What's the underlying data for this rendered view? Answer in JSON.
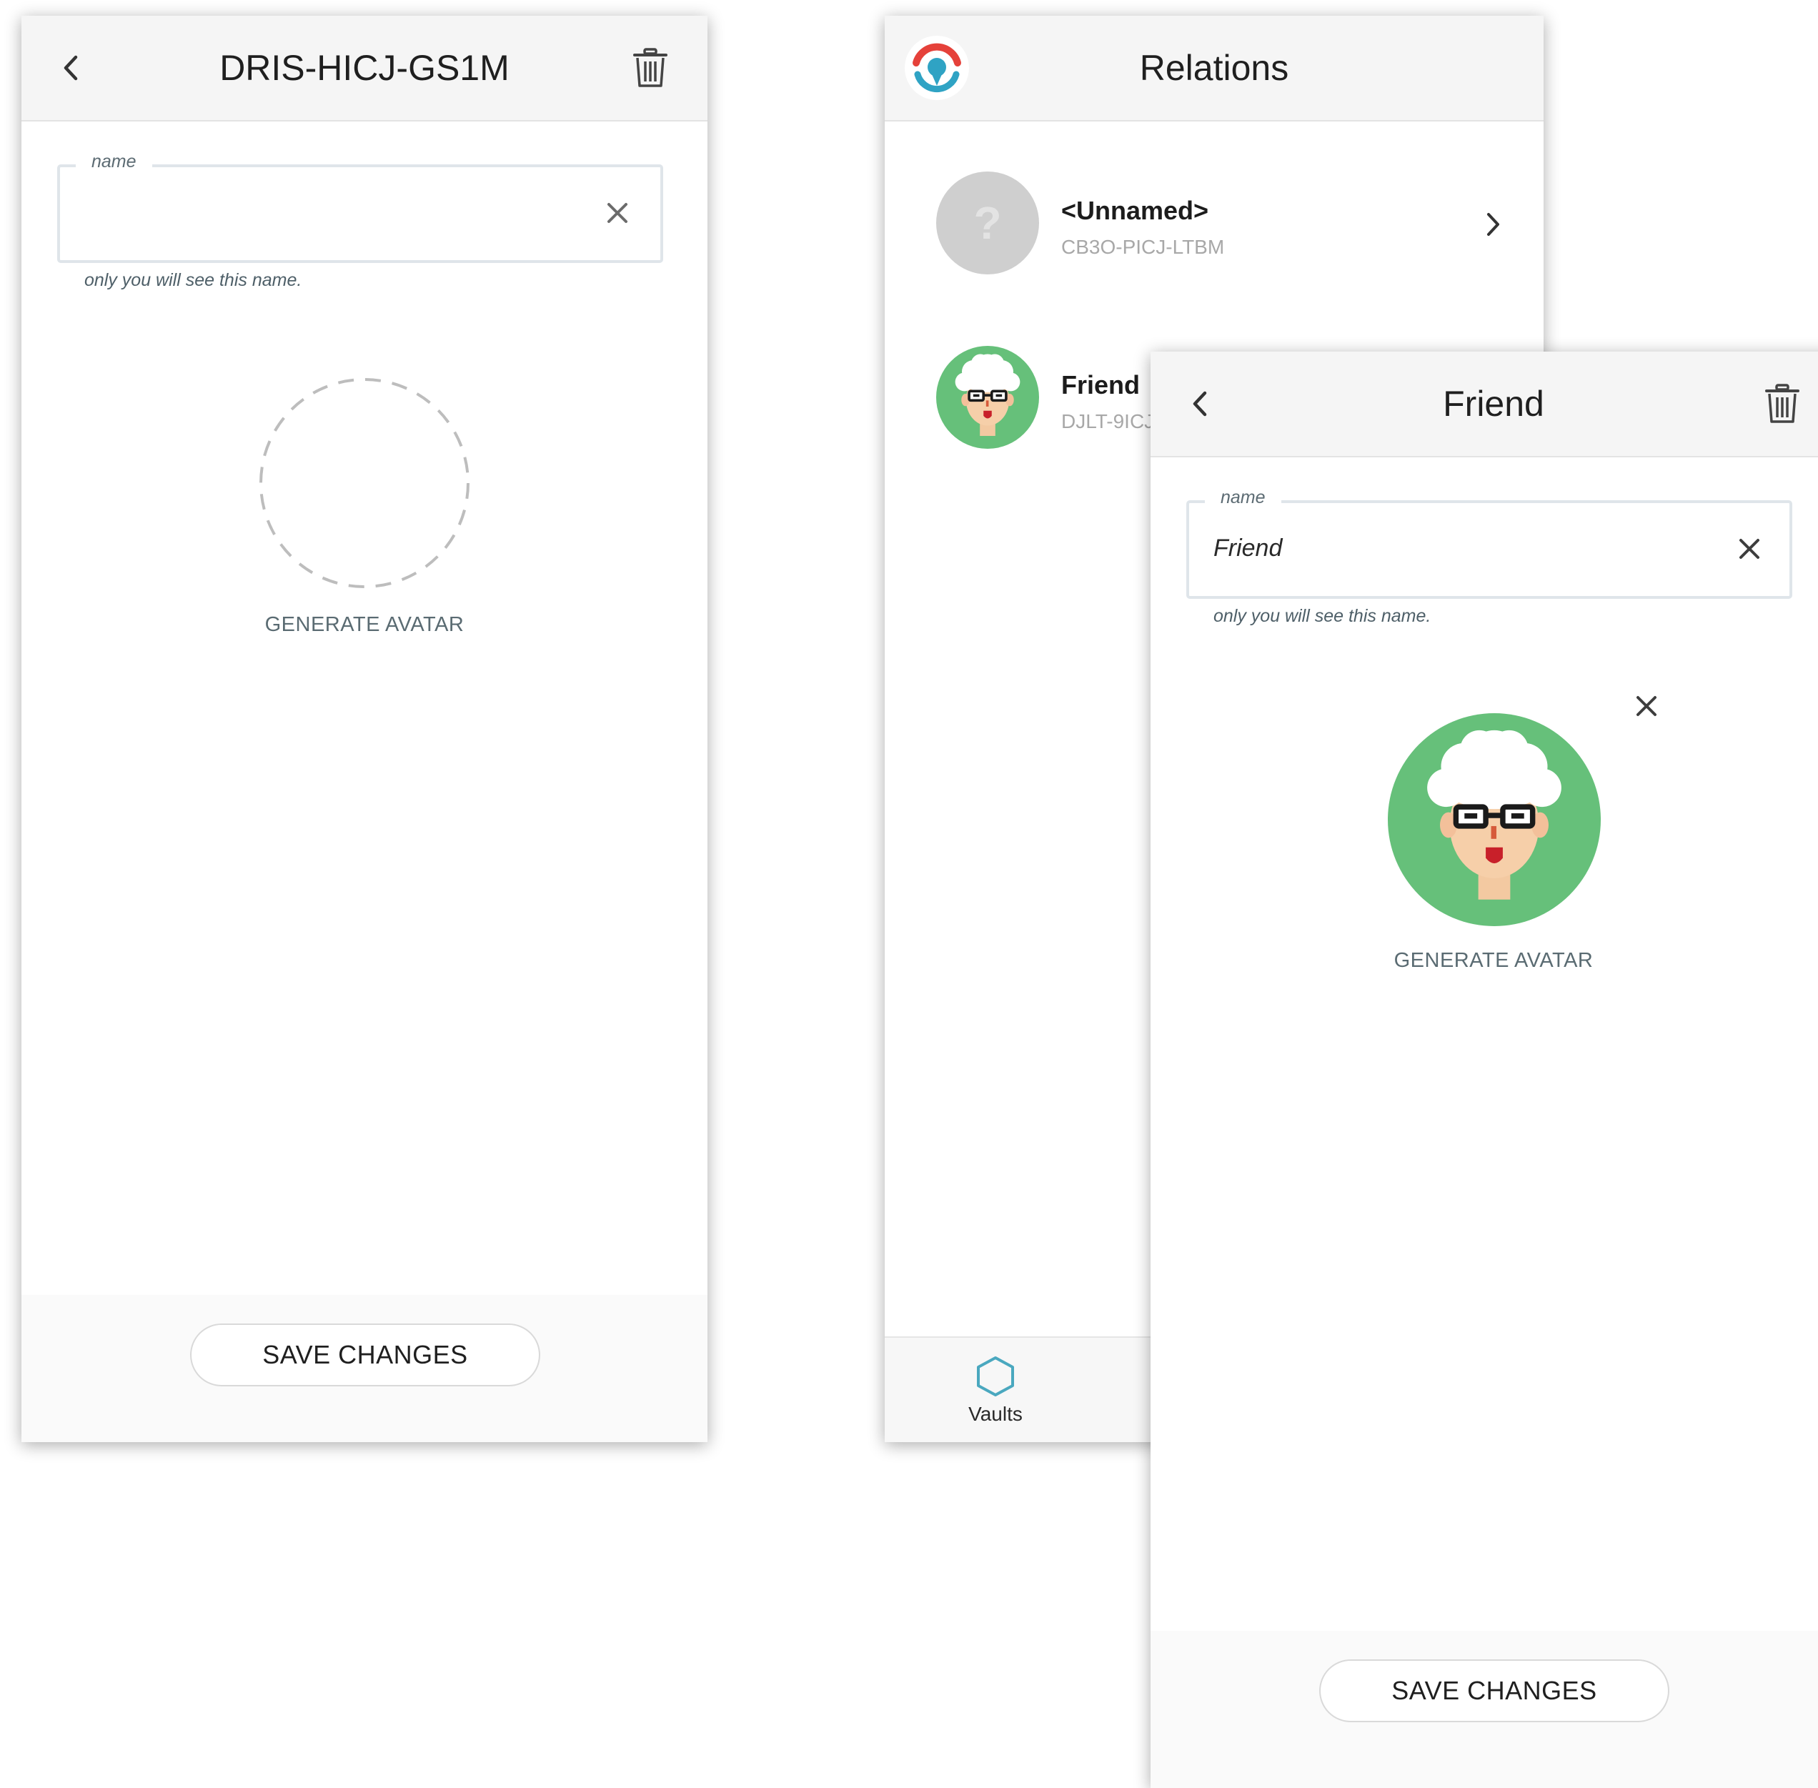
{
  "left_screen": {
    "header_title": "DRIS-HICJ-GS1M",
    "name_field": {
      "label": "name",
      "value": ""
    },
    "hint": "only you will see this name.",
    "generate_avatar_label": "GENERATE AVATAR",
    "save_label": "SAVE CHANGES"
  },
  "middle_screen": {
    "header_title": "Relations",
    "items": [
      {
        "name": "<Unnamed>",
        "id": "CB3O-PICJ-LTBM",
        "avatar_glyph": "?"
      },
      {
        "name": "Friend",
        "id": "DJLT-9ICJ"
      }
    ],
    "bottom_nav": {
      "vaults_label": "Vaults"
    }
  },
  "right_screen": {
    "header_title": "Friend",
    "name_field": {
      "label": "name",
      "value": "Friend"
    },
    "hint": "only you will see this name.",
    "generate_avatar_label": "GENERATE AVATAR",
    "save_label": "SAVE CHANGES"
  },
  "colors": {
    "avatar_green": "#66c07a",
    "hexagon_teal": "#4aa8bf",
    "logo_red": "#e5413a",
    "logo_teal": "#2fa3c4"
  }
}
